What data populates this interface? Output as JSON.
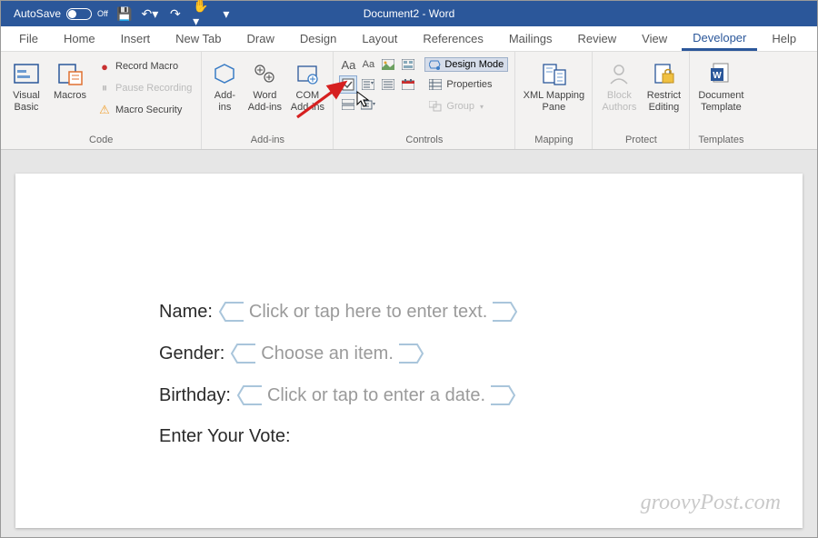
{
  "titlebar": {
    "autosave_label": "AutoSave",
    "autosave_state": "Off",
    "doc_title": "Document2  -  Word"
  },
  "tabs": {
    "file": "File",
    "home": "Home",
    "insert": "Insert",
    "newtab": "New Tab",
    "draw": "Draw",
    "design": "Design",
    "layout": "Layout",
    "references": "References",
    "mailings": "Mailings",
    "review": "Review",
    "view": "View",
    "developer": "Developer",
    "help": "Help"
  },
  "ribbon": {
    "code": {
      "label": "Code",
      "visual_basic": "Visual\nBasic",
      "macros": "Macros",
      "record": "Record Macro",
      "pause": "Pause Recording",
      "security": "Macro Security"
    },
    "addins": {
      "label": "Add-ins",
      "add_ins": "Add-\nins",
      "word_addins": "Word\nAdd-ins",
      "com_addins": "COM\nAdd-ins"
    },
    "controls": {
      "label": "Controls",
      "design_mode": "Design Mode",
      "properties": "Properties",
      "group": "Group"
    },
    "mapping": {
      "label": "Mapping",
      "xml": "XML Mapping\nPane"
    },
    "protect": {
      "label": "Protect",
      "block": "Block\nAuthors",
      "restrict": "Restrict\nEditing"
    },
    "templates": {
      "label": "Templates",
      "doc_template": "Document\nTemplate"
    }
  },
  "document": {
    "name_label": "Name:",
    "name_placeholder": "Click or tap here to enter text.",
    "gender_label": "Gender:",
    "gender_placeholder": "Choose an item.",
    "birthday_label": "Birthday:",
    "birthday_placeholder": "Click or tap to enter a date.",
    "vote_label": "Enter Your Vote:"
  },
  "watermark": "groovyPost.com"
}
